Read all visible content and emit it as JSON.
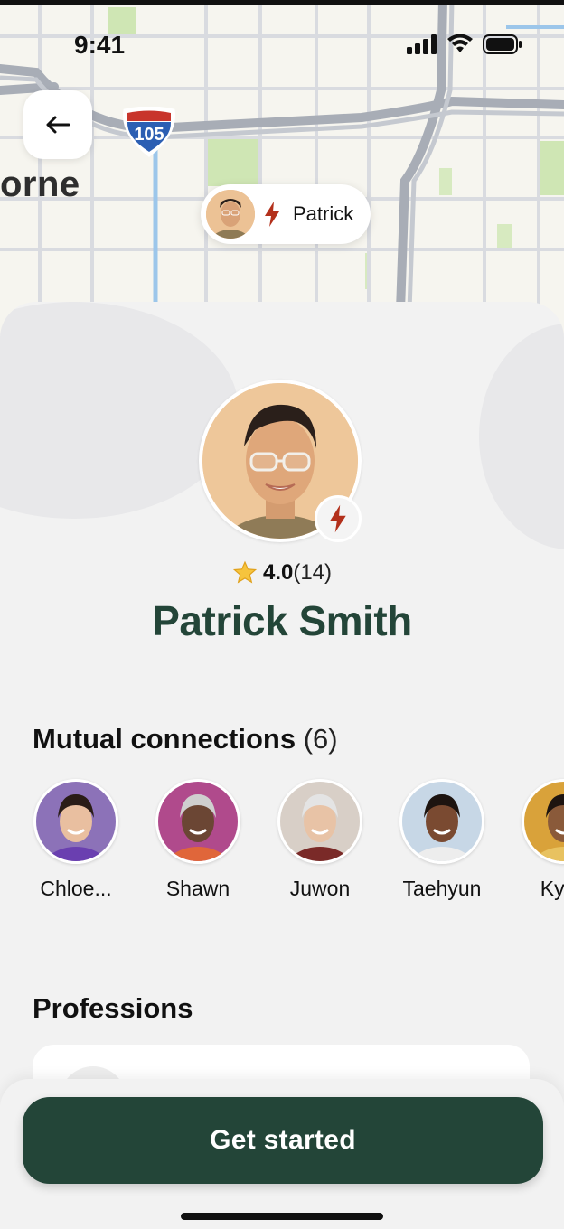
{
  "status_bar": {
    "time": "9:41"
  },
  "map": {
    "city_label": "orne",
    "highway_shield": "105",
    "pin": {
      "name": "Patrick"
    }
  },
  "profile": {
    "rating": "4.0",
    "reviews": "(14)",
    "name": "Patrick Smith"
  },
  "mutual_connections": {
    "title": "Mutual connections",
    "count": "(6)",
    "people": [
      {
        "label": "Chloe...",
        "bg": "#8c72b8",
        "skin": "#e9bfa0",
        "hair": "#2a1c17",
        "shirt": "#6a3fb0"
      },
      {
        "label": "Shawn",
        "bg": "#b04a8c",
        "skin": "#6b4634",
        "hair": "#cfcfcf",
        "shirt": "#e0663a"
      },
      {
        "label": "Juwon",
        "bg": "#d8cfc7",
        "skin": "#e8c3a6",
        "hair": "#e4e4e4",
        "shirt": "#7a2a28"
      },
      {
        "label": "Taehyun",
        "bg": "#c7d7e6",
        "skin": "#7a4a31",
        "hair": "#1d1410",
        "shirt": "#ededed"
      },
      {
        "label": "Kyun",
        "bg": "#d9a23a",
        "skin": "#8a5a3a",
        "hair": "#1d1410",
        "shirt": "#e8c260"
      }
    ]
  },
  "professions": {
    "title": "Professions"
  },
  "cta": {
    "label": "Get started"
  },
  "colors": {
    "brand": "#234538",
    "bolt": "#b3301b"
  }
}
